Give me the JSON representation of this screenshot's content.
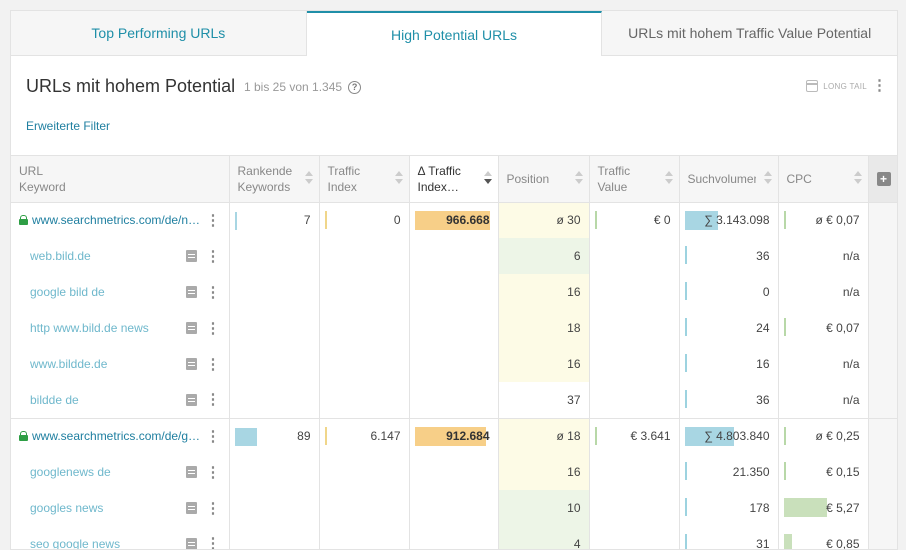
{
  "tabs": [
    {
      "label": "Top Performing URLs",
      "active": false
    },
    {
      "label": "High Potential URLs",
      "active": true
    },
    {
      "label": "URLs mit hohem Traffic Value Potential",
      "active": false
    }
  ],
  "header": {
    "title": "URLs mit hohem Potential",
    "count": "1 bis 25 von 1.345",
    "help_icon": "?",
    "filter_link": "Erweiterte Filter",
    "longtail_label": "LONG TAIL"
  },
  "columns": {
    "url_line1": "URL",
    "url_line2": "Keyword",
    "rk_line1": "Rankende",
    "rk_line2": "Keywords",
    "ti_line1": "Traffic",
    "ti_line2": "Index",
    "dti_line1": "Δ Traffic",
    "dti_line2": "Index…",
    "position": "Position",
    "tv_line1": "Traffic",
    "tv_line2": "Value",
    "sv": "Suchvolumen",
    "cpc": "CPC",
    "add": "+"
  },
  "groups": [
    {
      "url": "www.searchmetrics.com/de/ne…",
      "ranking_keywords": "7",
      "ranking_fraction": 0.0,
      "traffic_index": "0",
      "delta_traffic_index": "966.668",
      "delta_fraction": 0.96,
      "position": "ø 30",
      "traffic_value": "€ 0",
      "search_volume": "∑ 3.143.098",
      "sv_fraction": 0.37,
      "cpc": "ø € 0,07",
      "keywords": [
        {
          "keyword": "web.bild.de",
          "position": "6",
          "pos_tint": "green",
          "sv": "36",
          "cpc": "n/a",
          "cpc_tick": false
        },
        {
          "keyword": "google bild de",
          "position": "16",
          "pos_tint": "yellow",
          "sv": "0",
          "cpc": "n/a",
          "cpc_tick": false
        },
        {
          "keyword": "http www.bild.de news",
          "position": "18",
          "pos_tint": "yellow",
          "sv": "24",
          "cpc": "€ 0,07",
          "cpc_tick": true
        },
        {
          "keyword": "www.bildde.de",
          "position": "16",
          "pos_tint": "yellow",
          "sv": "16",
          "cpc": "n/a",
          "cpc_tick": false
        },
        {
          "keyword": "bildde de",
          "position": "37",
          "pos_tint": "none",
          "sv": "36",
          "cpc": "n/a",
          "cpc_tick": false
        }
      ]
    },
    {
      "url": "www.searchmetrics.com/de/gl…",
      "ranking_keywords": "89",
      "ranking_fraction": 0.28,
      "traffic_index": "6.147",
      "delta_traffic_index": "912.684",
      "delta_fraction": 0.91,
      "position": "ø 18",
      "traffic_value": "€ 3.641",
      "search_volume": "∑ 4.803.840",
      "sv_fraction": 0.56,
      "cpc": "ø € 0,25",
      "keywords": [
        {
          "keyword": "googlenews de",
          "position": "16",
          "pos_tint": "yellow",
          "sv": "21.350",
          "cpc": "€ 0,15",
          "cpc_tick": true
        },
        {
          "keyword": "googles news",
          "position": "10",
          "pos_tint": "green",
          "sv": "178",
          "cpc": "€ 5,27",
          "cpc_tick": false,
          "cpc_fraction": 0.52
        },
        {
          "keyword": "seo google news",
          "position": "4",
          "pos_tint": "green",
          "sv": "31",
          "cpc": "€ 0,85",
          "cpc_tick": false,
          "cpc_fraction": 0.1
        }
      ]
    }
  ]
}
